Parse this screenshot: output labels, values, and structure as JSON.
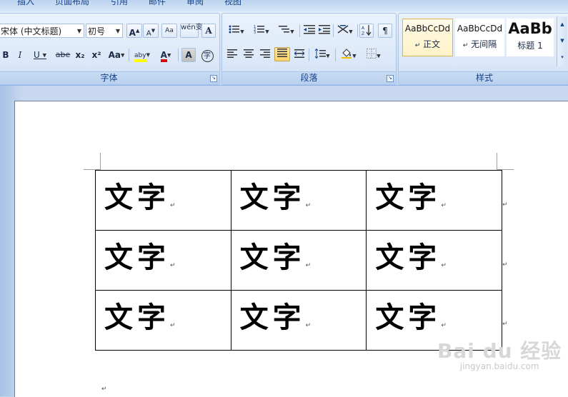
{
  "ribbon": {
    "tabs": [
      "插入",
      "页面布局",
      "引用",
      "邮件",
      "审阅",
      "视图"
    ],
    "font_group": {
      "label": "字体",
      "font_name": "宋体 (中文标题)",
      "font_size": "初号",
      "grow_font": "A",
      "shrink_font": "A",
      "clear_format_glyph": "Aa",
      "phonetic_glyph": "wén变",
      "char_border_glyph": "A",
      "bold": "B",
      "italic": "I",
      "underline": "U",
      "strikethrough": "abe",
      "subscript": "x₂",
      "superscript": "x²",
      "change_case": "Aa",
      "highlight": "aby",
      "font_color": "A",
      "char_shading": "A",
      "enclose_char": "字",
      "highlight_color": "#ffff00",
      "font_color_value": "#e00000"
    },
    "paragraph_group": {
      "label": "段落",
      "bullets_icon": "bulleted-list-icon",
      "numbering_icon": "numbered-list-icon",
      "multilevel_icon": "multilevel-list-icon",
      "decrease_indent_icon": "decrease-indent-icon",
      "increase_indent_icon": "increase-indent-icon",
      "chinese_layout_icon": "chinese-layout-icon",
      "sort_icon": "sort-icon",
      "show_marks_glyph": "¶"
    },
    "styles_group": {
      "label": "样式",
      "styles": [
        {
          "sample": "AaBbCcDd",
          "name": "正文",
          "mark": "↵",
          "selected": true
        },
        {
          "sample": "AaBbCcDd",
          "name": "无间隔",
          "mark": "↵",
          "selected": false
        },
        {
          "sample": "AaBb",
          "name": "标题 1",
          "mark": "",
          "selected": false
        }
      ]
    }
  },
  "document": {
    "cell_text": "文字",
    "paragraph_mark": "↵",
    "table": [
      [
        "文字",
        "文字",
        "文字"
      ],
      [
        "文字",
        "文字",
        "文字"
      ],
      [
        "文字",
        "文字",
        "文字"
      ]
    ]
  },
  "watermark": {
    "logo": "Bai du 经验",
    "site": "jingyan.baidu.com"
  }
}
